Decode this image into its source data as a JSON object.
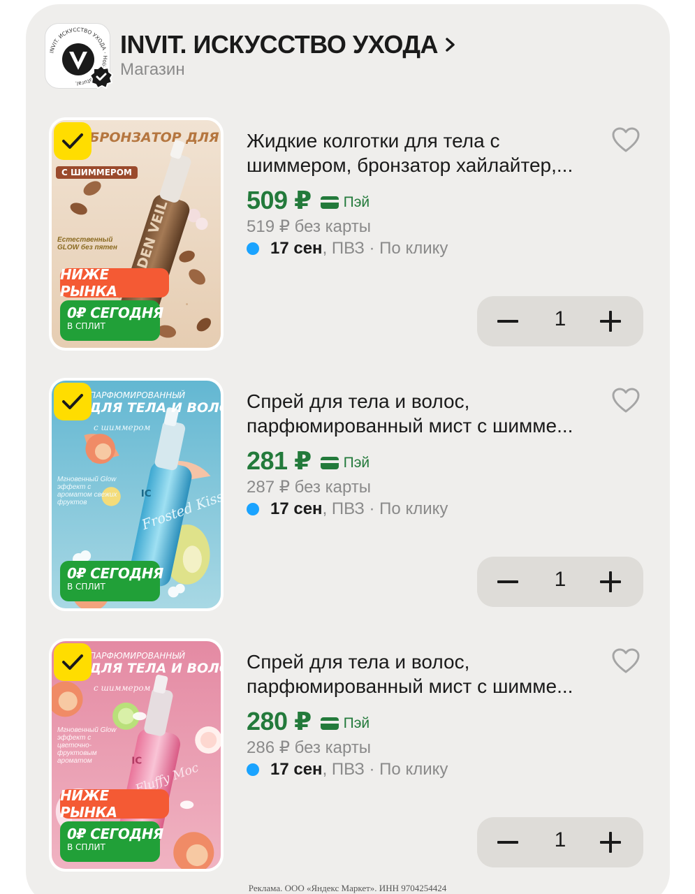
{
  "shop": {
    "title": "INVIT. ИСКУССТВО УХОДА",
    "subtitle": "Магазин",
    "logo_ring_text": "INVIT. ИСКУССТВО УХОДА · Holistic. Natural.",
    "logo_icon": "invit-v-logo",
    "badge_icon": "verified-badge-icon"
  },
  "products": [
    {
      "title_line1": "Жидкие колготки для тела с",
      "title_line2": "шиммером, бронзатор хайлайтер,...",
      "price": "509 ₽",
      "pay_label": "Пэй",
      "old_price": "519 ₽  без карты",
      "delivery_date": "17 сен",
      "delivery_rest": ", ПВЗ · По клику",
      "quantity": "1",
      "image": {
        "headline": "БРОНЗАТОР ДЛЯ ТЕЛА",
        "tag": "С ШИММЕРОМ",
        "note": "Естественный GLOW без пятен",
        "bottle_text": "DEN VEIL",
        "promo_red": "НИЖЕ РЫНКА",
        "promo_green_big": "0₽ СЕГОДНЯ",
        "promo_green_small": "В СПЛИТ"
      }
    },
    {
      "title_line1": "Спрей для тела и волос,",
      "title_line2": "парфюмированный мист с шимме...",
      "price": "281 ₽",
      "pay_label": "Пэй",
      "old_price": "287 ₽  без карты",
      "delivery_date": "17 сен",
      "delivery_rest": ", ПВЗ · По клику",
      "quantity": "1",
      "image": {
        "headline_small": "ПАРФЮМИРОВАННЫЙ",
        "headline": "ДЛЯ ТЕЛА И ВОЛОС",
        "tag": "с шиммером",
        "note": "Мгновенный Glow эффект с ароматом свежих фруктов",
        "bottle_text": "Frosted Kiss",
        "promo_green_big": "0₽ СЕГОДНЯ",
        "promo_green_small": "В СПЛИТ"
      }
    },
    {
      "title_line1": "Спрей для тела и волос,",
      "title_line2": "парфюмированный мист с шимме...",
      "price": "280 ₽",
      "pay_label": "Пэй",
      "old_price": "286 ₽  без карты",
      "delivery_date": "17 сен",
      "delivery_rest": ", ПВЗ · По клику",
      "quantity": "1",
      "image": {
        "headline_small": "ПАРФЮМИРОВАННЫЙ",
        "headline": "ДЛЯ ТЕЛА И ВОЛОС",
        "tag": "с шиммером",
        "note": "Мгновенный Glow эффект с цветочно-фруктовым ароматом",
        "bottle_text": "Fluffy Moc",
        "promo_red": "НИЖЕ РЫНКА",
        "promo_green_big": "0₽ СЕГОДНЯ",
        "promo_green_small": "В СПЛИТ"
      }
    }
  ],
  "footer": {
    "text": "Реклама. ООО «Яндекс Маркет». ИНН 9704254424"
  },
  "colors": {
    "card_bg": "#efeeec",
    "price_green": "#237a3b",
    "check_yellow": "#ffdd00",
    "promo_red": "#f45a34",
    "promo_green": "#21a038",
    "delivery_dot": "#1aa3ff",
    "stepper_bg": "#dedcd8"
  }
}
